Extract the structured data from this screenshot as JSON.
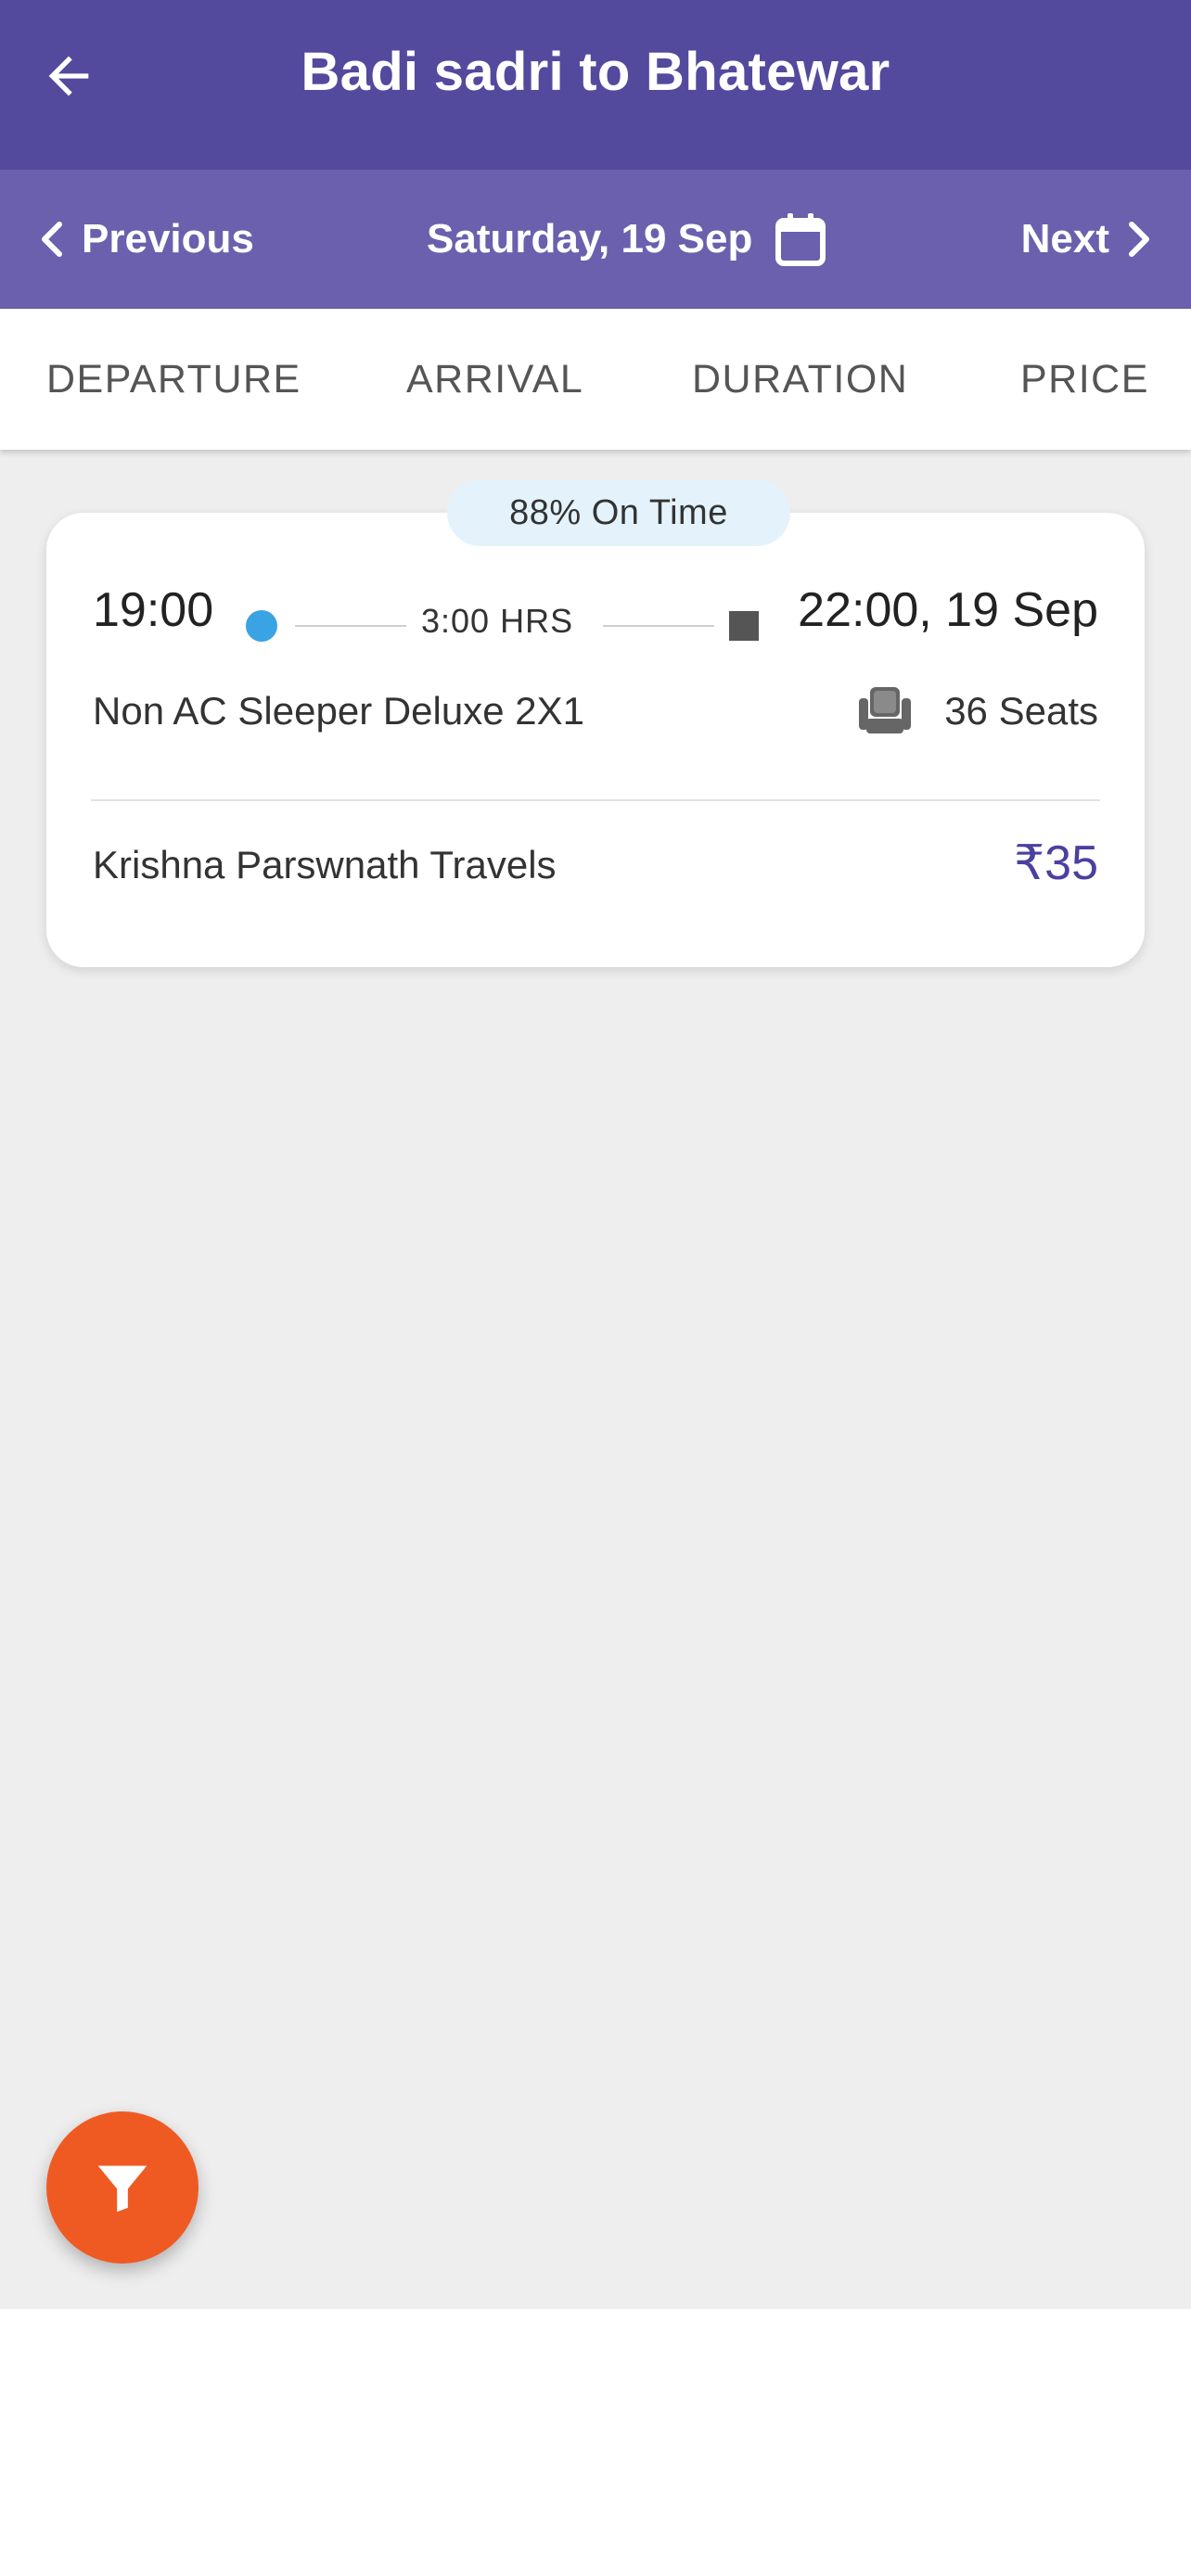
{
  "header": {
    "title": "Badi sadri to Bhatewar",
    "back_icon": "arrow-left-icon"
  },
  "datebar": {
    "previous_label": "Previous",
    "date_label": "Saturday, 19 Sep",
    "next_label": "Next",
    "calendar_icon": "calendar-icon"
  },
  "sort_tabs": [
    {
      "label": "DEPARTURE"
    },
    {
      "label": "ARRIVAL"
    },
    {
      "label": "DURATION"
    },
    {
      "label": "PRICE"
    }
  ],
  "results": [
    {
      "on_time": "88% On Time",
      "departure_time": "19:00",
      "duration": "3:00 HRS",
      "arrival": "22:00, 19 Sep",
      "bus_type": "Non AC Sleeper Deluxe 2X1",
      "seats": "36 Seats",
      "operator": "Krishna Parswnath Travels",
      "price": "₹35"
    }
  ],
  "fab": {
    "icon": "filter-icon"
  },
  "colors": {
    "header_bg": "#534a9e",
    "datebar_bg": "#6a60ad",
    "price": "#4a40a0",
    "fab": "#ef5a23",
    "departure_dot": "#3aa3e3",
    "content_bg": "#eeeeee"
  }
}
